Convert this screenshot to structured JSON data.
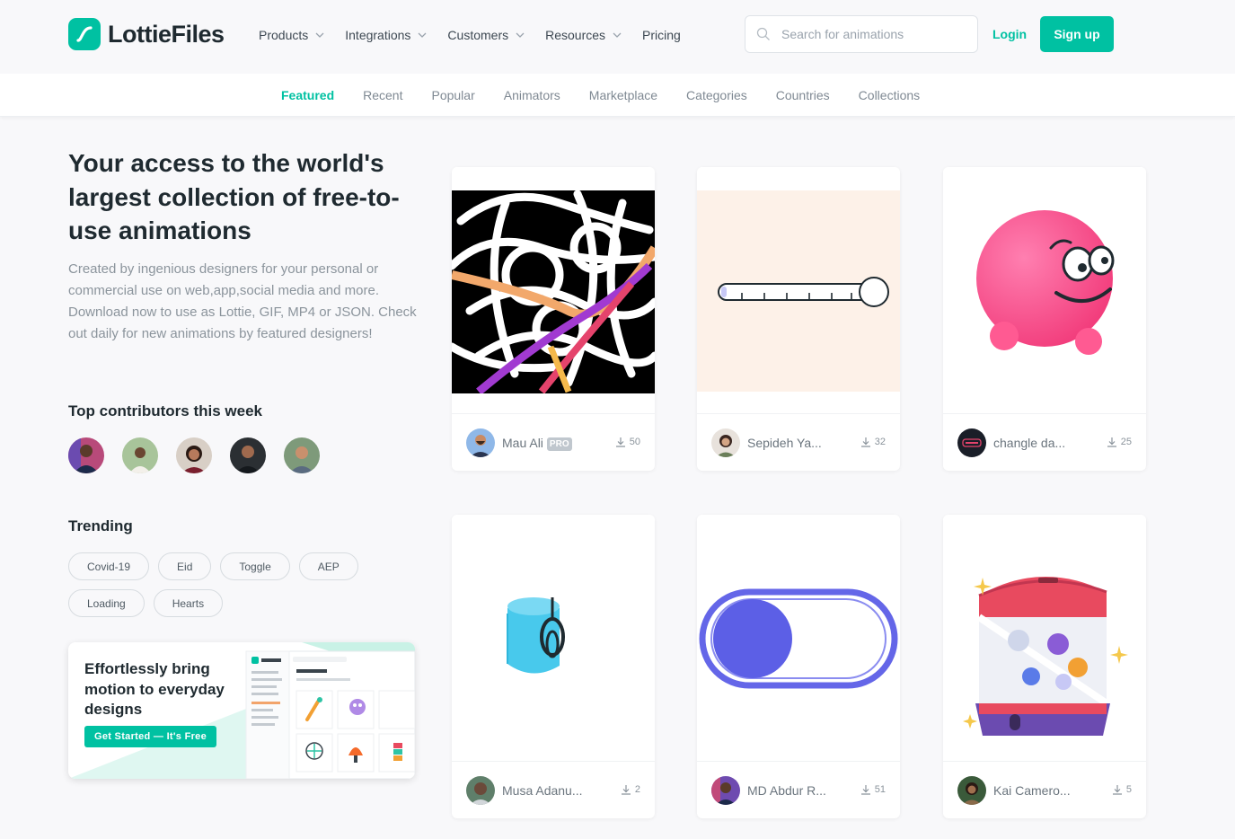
{
  "header": {
    "logo_text": "LottieFiles",
    "nav": [
      {
        "label": "Products",
        "dropdown": true
      },
      {
        "label": "Integrations",
        "dropdown": true
      },
      {
        "label": "Customers",
        "dropdown": true
      },
      {
        "label": "Resources",
        "dropdown": true
      },
      {
        "label": "Pricing",
        "dropdown": false
      }
    ],
    "search_placeholder": "Search for animations",
    "login_label": "Login",
    "signup_label": "Sign up"
  },
  "subnav": {
    "items": [
      "Featured",
      "Recent",
      "Popular",
      "Animators",
      "Marketplace",
      "Categories",
      "Countries",
      "Collections"
    ],
    "active": "Featured"
  },
  "hero": {
    "title": "Your access to the world's largest collection of free-to-use animations",
    "description": "Created by ingenious designers for your personal or commercial use on web,app,social media and more. Download now to use as Lottie, GIF, MP4 or JSON. Check out daily for new animations by featured designers!"
  },
  "contributors": {
    "title": "Top contributors this week",
    "count": 5
  },
  "trending": {
    "title": "Trending",
    "tags": [
      "Covid-19",
      "Eid",
      "Toggle",
      "AEP",
      "Loading",
      "Hearts"
    ]
  },
  "promo": {
    "title": "Effortlessly bring motion to everyday designs",
    "button": "Get Started — It's Free"
  },
  "cards": [
    {
      "author": "Mau Ali",
      "pro": true,
      "pro_label": "PRO",
      "downloads": "50"
    },
    {
      "author": "Sepideh Ya...",
      "pro": false,
      "downloads": "32"
    },
    {
      "author": "changle da...",
      "pro": false,
      "downloads": "25"
    },
    {
      "author": "Musa Adanu...",
      "pro": false,
      "downloads": "2"
    },
    {
      "author": "MD Abdur R...",
      "pro": false,
      "downloads": "51"
    },
    {
      "author": "Kai Camero...",
      "pro": false,
      "downloads": "5"
    }
  ],
  "colors": {
    "brand": "#00c1a2",
    "text": "#1f2a30",
    "muted": "#8b949c"
  }
}
